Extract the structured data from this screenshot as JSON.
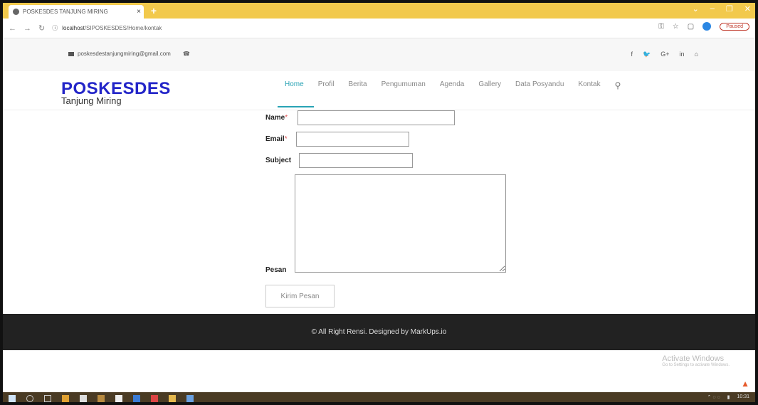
{
  "browser": {
    "tab_title": "POSKESDES TANJUNG MIRING",
    "tab_close": "×",
    "new_tab": "+",
    "url_host": "localhost",
    "url_path": "/SIPOSKESDES/Home/kontak",
    "paused_label": "Paused"
  },
  "infobar": {
    "email": "poskesdestanjungmiring@gmail.com",
    "social": [
      "f",
      "🐦",
      "G+",
      "in",
      "⌂"
    ]
  },
  "header": {
    "logo_title": "POSKESDES",
    "logo_subtitle": "Tanjung Miring",
    "menu": [
      "Home",
      "Profil",
      "Berita",
      "Pengumuman",
      "Agenda",
      "Gallery",
      "Data Posyandu",
      "Kontak"
    ],
    "active_item": "Home"
  },
  "form": {
    "name_label": "Name",
    "email_label": "Email",
    "subject_label": "Subject",
    "pesan_label": "Pesan",
    "required_mark": "*",
    "submit_label": "Kirim Pesan",
    "name_value": "",
    "email_value": "",
    "subject_value": "",
    "pesan_value": ""
  },
  "footer": {
    "text": "© All Right Rensi. Designed by MarkUps.io"
  },
  "watermark": {
    "title": "Activate Windows",
    "subtitle": "Go to Settings to activate Windows."
  },
  "taskbar": {
    "time": "10:31"
  },
  "colors": {
    "accent": "#29a3b5",
    "logo": "#2325c8",
    "footer_bg": "#222222",
    "tabbar": "#f2c94c"
  }
}
